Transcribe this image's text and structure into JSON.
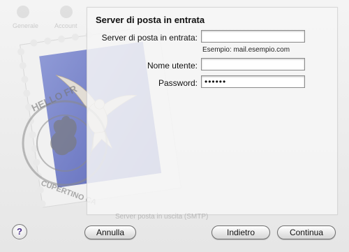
{
  "sheet": {
    "title": "Server di posta in entrata",
    "fields": {
      "server_label": "Server di posta in entrata:",
      "server_value": "",
      "server_example": "Esempio: mail.esempio.com",
      "username_label": "Nome utente:",
      "username_value": "",
      "password_label": "Password:",
      "password_value": "••••••"
    }
  },
  "background": {
    "stamp_text_top": "HELLO FR",
    "stamp_text_bottom": "CUPERTINO CA",
    "ghost_text": "Server posta in uscita (SMTP)",
    "toolbar_labels": [
      "Generale",
      "Account"
    ]
  },
  "footer": {
    "help_label": "?",
    "cancel_label": "Annulla",
    "back_label": "Indietro",
    "continue_label": "Continua"
  }
}
